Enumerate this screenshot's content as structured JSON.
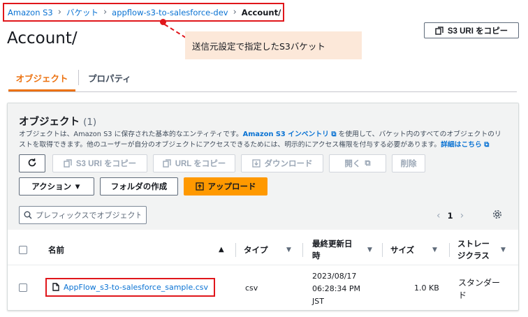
{
  "breadcrumb": {
    "items": [
      "Amazon S3",
      "バケット",
      "appflow-s3-to-salesforce-dev"
    ],
    "current": "Account/"
  },
  "annotation": {
    "text": "送信元設定で指定したS3バケット"
  },
  "page": {
    "title": "Account/",
    "copy_uri_label": "S3 URI をコピー"
  },
  "tabs": [
    {
      "label": "オブジェクト",
      "active": true
    },
    {
      "label": "プロパティ",
      "active": false
    }
  ],
  "objects": {
    "heading": "オブジェクト",
    "count": "(1)",
    "desc_part1": "オブジェクトは、Amazon S3 に保存された基本的なエンティティです。",
    "desc_link1": "Amazon S3 インベントリ",
    "desc_part2": " を使用して、バケット内のすべてのオブジェクトのリストを取得できます。他のユーザーが自分のオブジェクトにアクセスできるためには、明示的にアクセス権限を付与する必要があります。",
    "desc_link2": "詳細はこちら"
  },
  "toolbar": {
    "refresh": "refresh-icon",
    "copy_s3_uri": "S3 URI をコピー",
    "copy_url": "URL をコピー",
    "download": "ダウンロード",
    "open": "開く",
    "delete": "削除",
    "actions": "アクション ▼",
    "create_folder": "フォルダの作成",
    "upload": "アップロード"
  },
  "search": {
    "placeholder": "プレフィックスでオブジェクトを検索"
  },
  "pagination": {
    "page": "1"
  },
  "table": {
    "columns": {
      "name": "名前",
      "type": "タイプ",
      "modified_line1": "最終更新日",
      "modified_line2": "時",
      "size": "サイズ",
      "storage_line1": "ストレー",
      "storage_line2": "ジクラス"
    },
    "rows": [
      {
        "name": "AppFlow_s3-to-salesforce_sample.csv",
        "type": "csv",
        "modified_line1": "2023/08/17",
        "modified_line2": "06:28:34 PM",
        "modified_line3": "JST",
        "size": "1.0 KB",
        "storage_line1": "スタンダー",
        "storage_line2": "ド"
      }
    ]
  },
  "colors": {
    "accent": "#ec7211",
    "link": "#0972d3",
    "highlight": "#e0161b",
    "primary_button": "#ff9900"
  }
}
